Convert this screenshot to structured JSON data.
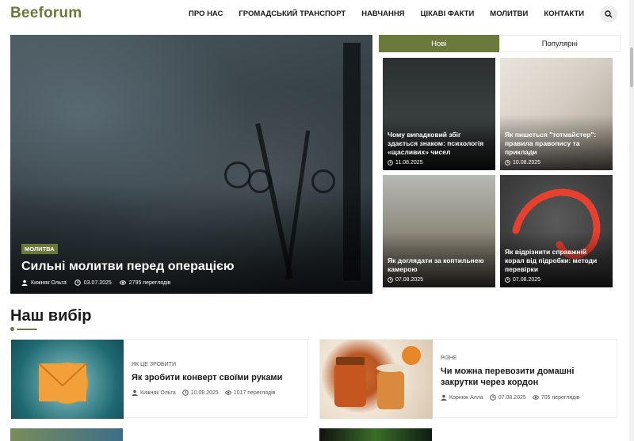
{
  "site": {
    "logo": "Beeforum"
  },
  "nav": [
    "ПРО НАС",
    "ГРОМАДСЬКИЙ ТРАНСПОРТ",
    "НАВЧАННЯ",
    "ЦІКАВІ ФАКТИ",
    "МОЛИТВИ",
    "КОНТАКТИ"
  ],
  "icons": {
    "search": "search-icon",
    "user": "user-icon",
    "clock": "clock-icon",
    "eye": "eye-icon"
  },
  "hero": {
    "category": "МОЛИТВА",
    "title": "Сильні молитви перед операцією",
    "author": "Кижняк Ольга",
    "date": "03.07.2025",
    "views": "2795 переглядів"
  },
  "tabs": {
    "active": "Нові",
    "inactive": "Популярні"
  },
  "grid": [
    {
      "title": "Чому випадковий збіг здається знаком: психологія «щасливих» чисел",
      "date": "11.08.2025"
    },
    {
      "title": "Як пишеться \"тотмайстер\": правила правопису та приклади",
      "date": "10.08.2025"
    },
    {
      "title": "Як доглядати за коптильнею камерою",
      "date": "07.08.2025"
    },
    {
      "title": "Як відрізнити справжній корал від підробки: методи перевірки",
      "date": "07.08.2025"
    }
  ],
  "section": {
    "title": "Наш вибір"
  },
  "posts": [
    {
      "category": "ЯК ЦЕ ЗРОБИТИ",
      "title": "Як зробити конверт своїми руками",
      "author": "Кижняк Ольга",
      "date": "10.08.2025",
      "views": "1017 переглядів"
    },
    {
      "category": "РІЗНЕ",
      "title": "Чи можна перевозити домашні закрутки через кордон",
      "author": "Корнюк Алла",
      "date": "07.08.2025",
      "views": "705 переглядів"
    }
  ],
  "colors": {
    "accent": "#6b7a3c",
    "text": "#1a1a1a",
    "search_bg": "#ececec"
  }
}
